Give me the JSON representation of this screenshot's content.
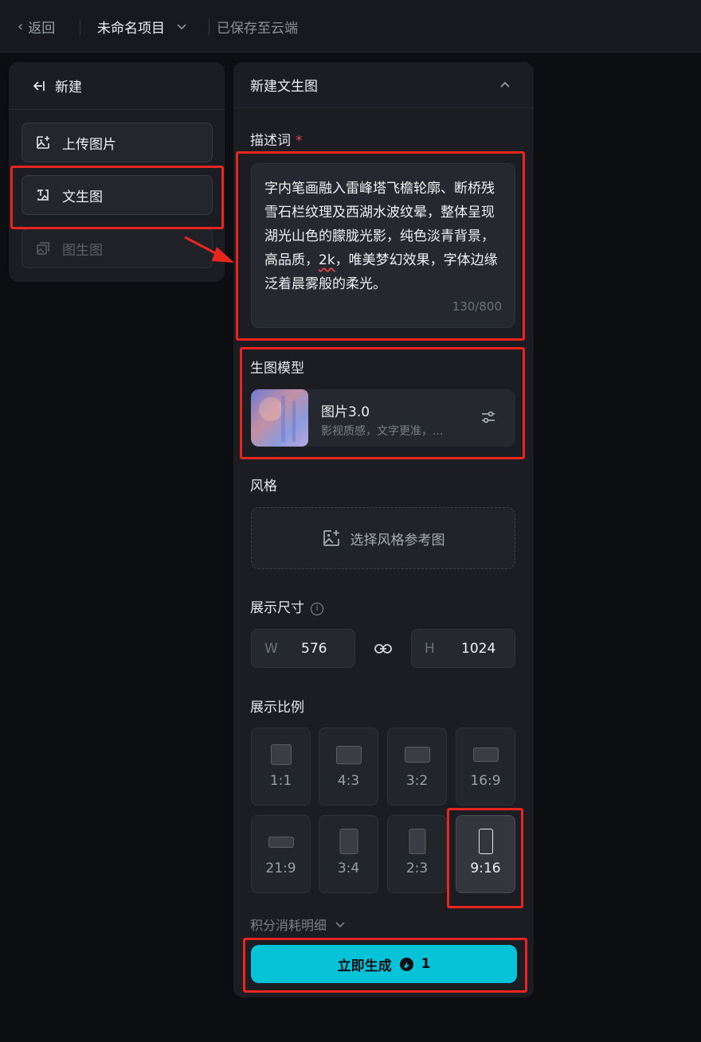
{
  "topbar": {
    "back_label": "返回",
    "project_title": "未命名项目",
    "save_status": "已保存至云端"
  },
  "left_panel": {
    "header_label": "新建",
    "items": [
      {
        "label": "上传图片",
        "icon": "upload-image-icon",
        "disabled": false
      },
      {
        "label": "文生图",
        "icon": "text-to-image-icon",
        "disabled": false
      },
      {
        "label": "图生图",
        "icon": "image-to-image-icon",
        "disabled": true
      }
    ]
  },
  "right_panel": {
    "title": "新建文生图",
    "prompt": {
      "label": "描述词",
      "required_mark": "*",
      "text_before": "字内笔画融入雷峰塔飞檐轮廓、断桥残雪石栏纹理及西湖水波纹晕，整体呈现湖光山色的朦胧光影，纯色淡青背景，高品质，",
      "text_flagged": "2k",
      "text_after": "，唯美梦幻效果，字体边缘泛着晨雾般的柔光。",
      "count": "130/800"
    },
    "model": {
      "label": "生图模型",
      "name": "图片3.0",
      "description": "影视质感，文字更准，..."
    },
    "style": {
      "label": "风格",
      "placeholder": "选择风格参考图"
    },
    "size": {
      "label": "展示尺寸",
      "width_key": "W",
      "width": "576",
      "height_key": "H",
      "height": "1024"
    },
    "ratio": {
      "label": "展示比例",
      "options": [
        "1:1",
        "4:3",
        "3:2",
        "16:9",
        "21:9",
        "3:4",
        "2:3",
        "9:16"
      ],
      "selected": "9:16"
    },
    "credits_label": "积分消耗明细",
    "generate_label": "立即生成",
    "generate_cost": "1"
  },
  "annotation_color": "#e8261f",
  "accent_color": "#06c3d8"
}
